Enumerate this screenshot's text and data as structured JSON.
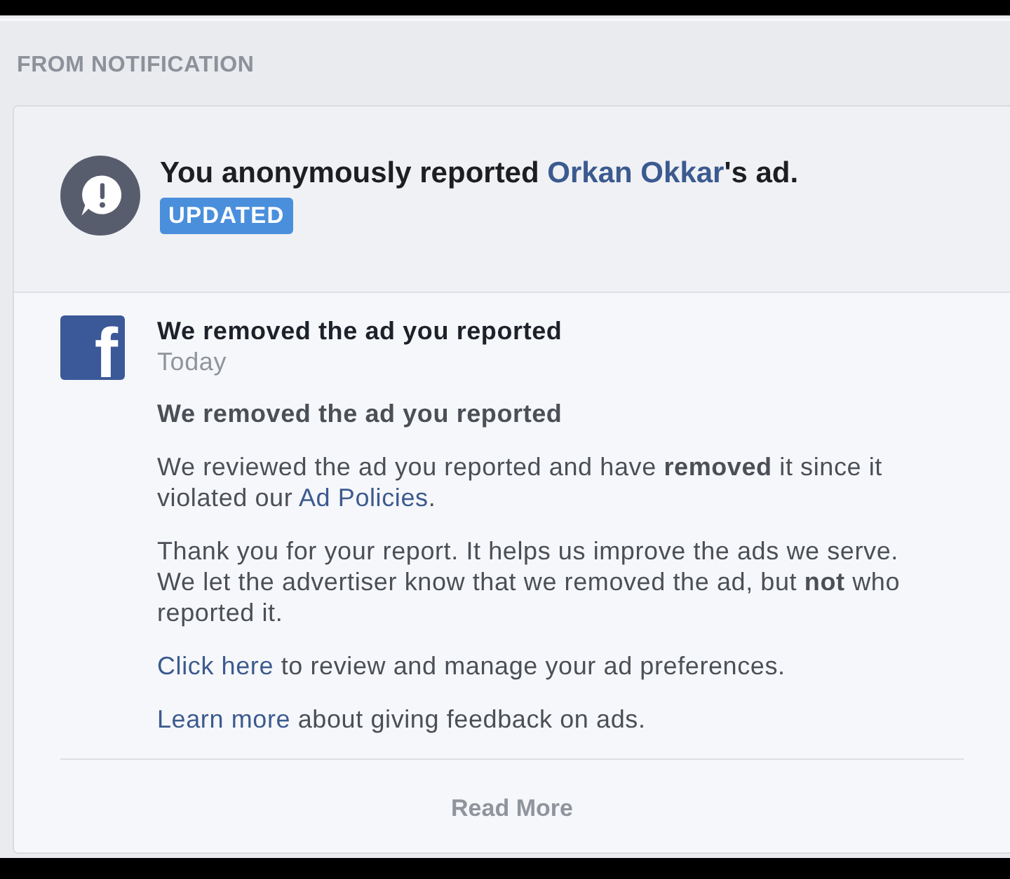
{
  "section_label": "FROM NOTIFICATION",
  "report": {
    "title": [
      {
        "kind": "text",
        "text": "You anonymously reported "
      },
      {
        "kind": "link",
        "text": "Orkan Okkar"
      },
      {
        "kind": "text",
        "text": "'s ad."
      }
    ],
    "badge": "UPDATED"
  },
  "message": {
    "logo": "f",
    "title": "We removed the ad you reported",
    "time": "Today",
    "heading": "We removed the ad you reported",
    "paragraphs": [
      [
        {
          "kind": "text",
          "text": "We reviewed the ad you reported and have **removed** it since it violated our "
        },
        {
          "kind": "link",
          "text": "Ad Policies"
        },
        {
          "kind": "text",
          "text": "."
        }
      ],
      [
        {
          "kind": "text",
          "text": "Thank you for your report. It helps us improve the ads we serve. We let the advertiser know that we removed the ad, but **not** who reported it."
        }
      ],
      [
        {
          "kind": "link",
          "text": "Click here"
        },
        {
          "kind": "text",
          "text": " to review and manage your ad preferences."
        }
      ],
      [
        {
          "kind": "link",
          "text": "Learn more"
        },
        {
          "kind": "text",
          "text": " about giving feedback on ads."
        }
      ]
    ],
    "read_more": "Read More"
  }
}
